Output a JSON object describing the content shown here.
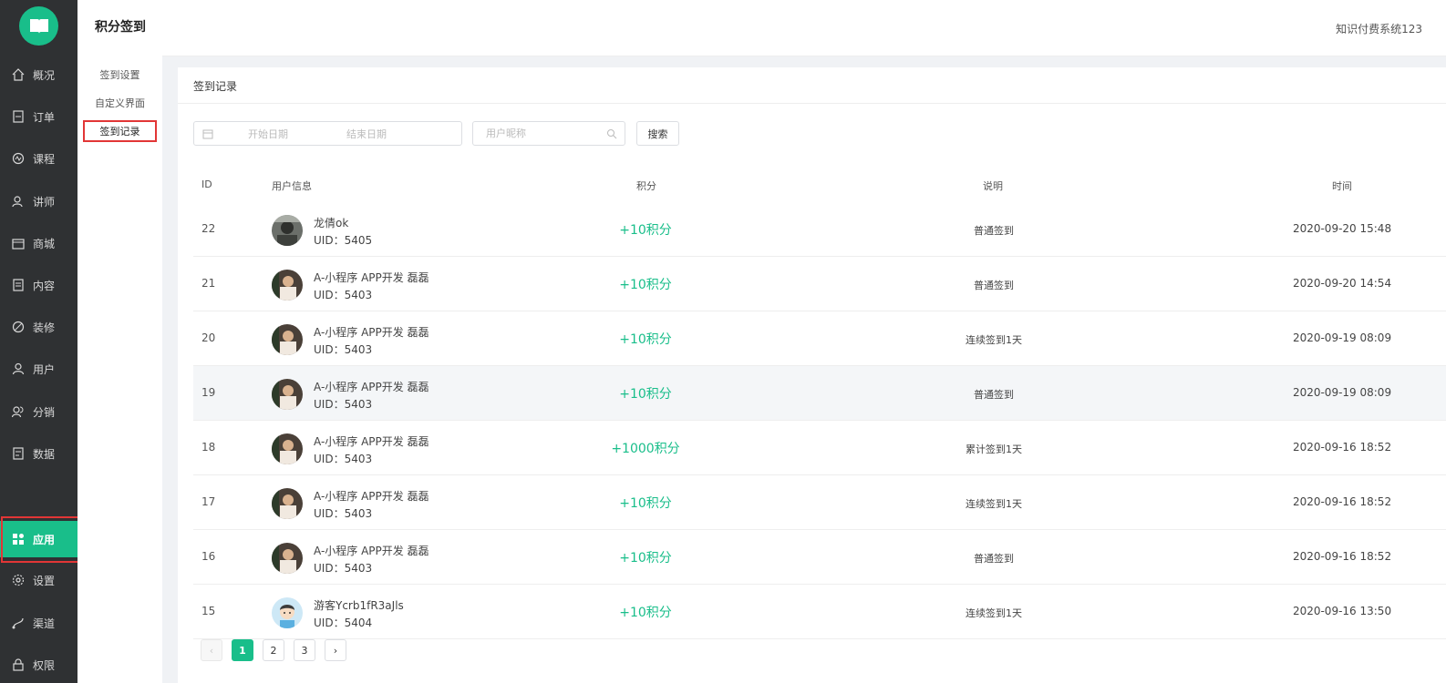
{
  "colors": {
    "accent": "#19be8a",
    "sidebar": "#2f3133",
    "highlight": "#e23636"
  },
  "nav": {
    "items": [
      {
        "label": "概况",
        "icon": "home-icon"
      },
      {
        "label": "订单",
        "icon": "order-icon"
      },
      {
        "label": "课程",
        "icon": "course-icon"
      },
      {
        "label": "讲师",
        "icon": "teacher-icon"
      },
      {
        "label": "商城",
        "icon": "store-icon"
      },
      {
        "label": "内容",
        "icon": "content-icon"
      },
      {
        "label": "装修",
        "icon": "decorate-icon"
      },
      {
        "label": "用户",
        "icon": "user-icon"
      },
      {
        "label": "分销",
        "icon": "distribution-icon"
      },
      {
        "label": "数据",
        "icon": "data-icon"
      },
      {
        "label": "应用",
        "icon": "apps-icon"
      },
      {
        "label": "设置",
        "icon": "settings-icon"
      },
      {
        "label": "渠道",
        "icon": "channel-icon"
      },
      {
        "label": "权限",
        "icon": "lock-icon"
      }
    ]
  },
  "subnav": {
    "title": "积分签到",
    "items": [
      {
        "label": "签到设置"
      },
      {
        "label": "自定义界面"
      },
      {
        "label": "签到记录"
      }
    ]
  },
  "header": {
    "system_name": "知识付费系统123"
  },
  "card": {
    "title": "签到记录",
    "filters": {
      "start_placeholder": "开始日期",
      "end_placeholder": "结束日期",
      "nickname_placeholder": "用户昵称",
      "search_label": "搜索"
    },
    "columns": [
      "ID",
      "用户信息",
      "积分",
      "说明",
      "时间"
    ],
    "rows": [
      {
        "id": "22",
        "name": "龙倩ok",
        "uid": "UID：5405",
        "points": "+10积分",
        "desc": "普通签到",
        "time": "2020-09-20 15:48",
        "avatar": "gray"
      },
      {
        "id": "21",
        "name": "A-小程序 APP开发 磊磊",
        "uid": "UID：5403",
        "points": "+10积分",
        "desc": "普通签到",
        "time": "2020-09-20 14:54",
        "avatar": "photo"
      },
      {
        "id": "20",
        "name": "A-小程序 APP开发 磊磊",
        "uid": "UID：5403",
        "points": "+10积分",
        "desc": "连续签到1天",
        "time": "2020-09-19 08:09",
        "avatar": "photo"
      },
      {
        "id": "19",
        "name": "A-小程序 APP开发 磊磊",
        "uid": "UID：5403",
        "points": "+10积分",
        "desc": "普通签到",
        "time": "2020-09-19 08:09",
        "avatar": "photo"
      },
      {
        "id": "18",
        "name": "A-小程序 APP开发 磊磊",
        "uid": "UID：5403",
        "points": "+1000积分",
        "desc": "累计签到1天",
        "time": "2020-09-16 18:52",
        "avatar": "photo"
      },
      {
        "id": "17",
        "name": "A-小程序 APP开发 磊磊",
        "uid": "UID：5403",
        "points": "+10积分",
        "desc": "连续签到1天",
        "time": "2020-09-16 18:52",
        "avatar": "photo"
      },
      {
        "id": "16",
        "name": "A-小程序 APP开发 磊磊",
        "uid": "UID：5403",
        "points": "+10积分",
        "desc": "普通签到",
        "time": "2020-09-16 18:52",
        "avatar": "photo"
      },
      {
        "id": "15",
        "name": "游客Ycrb1fR3aJls",
        "uid": "UID：5404",
        "points": "+10积分",
        "desc": "连续签到1天",
        "time": "2020-09-16 13:50",
        "avatar": "cartoon"
      }
    ]
  },
  "pagination": {
    "prev": "‹",
    "next": "›",
    "pages": [
      "1",
      "2",
      "3"
    ],
    "current": "1"
  }
}
